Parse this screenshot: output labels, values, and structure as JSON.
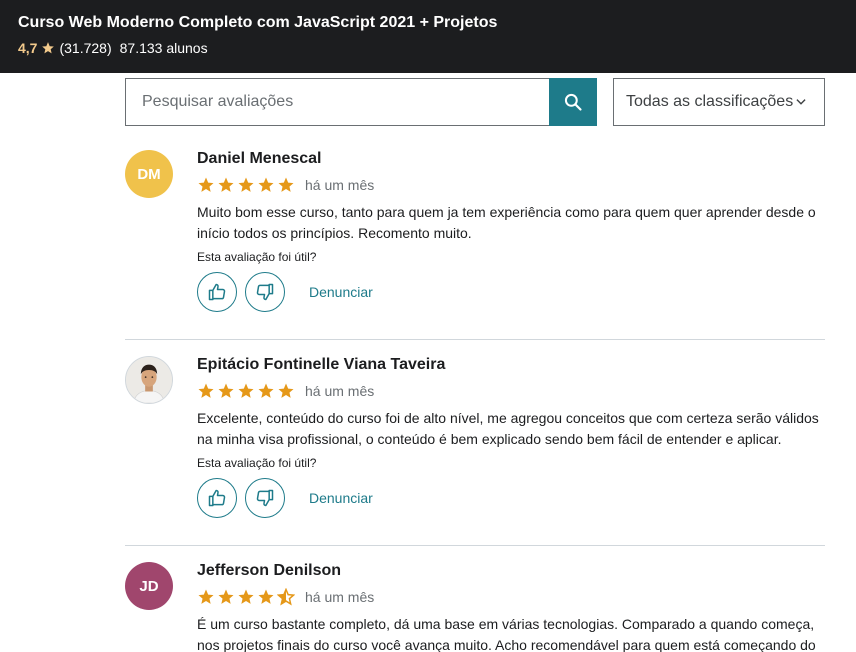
{
  "header": {
    "title": "Curso Web Moderno Completo com JavaScript 2021 + Projetos",
    "rating": "4,7",
    "rating_count": "(31.728)",
    "students": "87.133 alunos"
  },
  "search": {
    "placeholder": "Pesquisar avaliações",
    "filter_label": "Todas as classificações"
  },
  "colors": {
    "accent": "#1e7b8a",
    "star": "#e59819",
    "header_bg": "#1c1d1f"
  },
  "reviews": [
    {
      "initials": "DM",
      "avatar_color": "#f0c24b",
      "name": "Daniel Menescal",
      "rating": 5,
      "time": "há um mês",
      "text": "Muito bom esse curso, tanto para quem ja tem experiência como para quem quer aprender desde o início todos os princípios. Recomento muito.",
      "helpful": "Esta avaliação foi útil?",
      "report": "Denunciar"
    },
    {
      "initials": "",
      "avatar_color": "#e8e8e8",
      "name": "Epitácio Fontinelle Viana Taveira",
      "rating": 5,
      "time": "há um mês",
      "text": "Excelente, conteúdo do curso foi de alto nível, me agregou conceitos que com certeza serão válidos na minha visa profissional, o conteúdo é bem explicado sendo bem fácil de entender e aplicar.",
      "helpful": "Esta avaliação foi útil?",
      "report": "Denunciar"
    },
    {
      "initials": "JD",
      "avatar_color": "#a0466d",
      "name": "Jefferson Denilson",
      "rating": 4.5,
      "time": "há um mês",
      "text": "É um curso bastante completo, dá uma base em várias tecnologias. Comparado a quando começa, nos projetos finais do curso você avança muito. Acho recomendável para quem está começando do",
      "helpful": "Esta avaliação foi útil?",
      "report": "Denunciar"
    }
  ]
}
